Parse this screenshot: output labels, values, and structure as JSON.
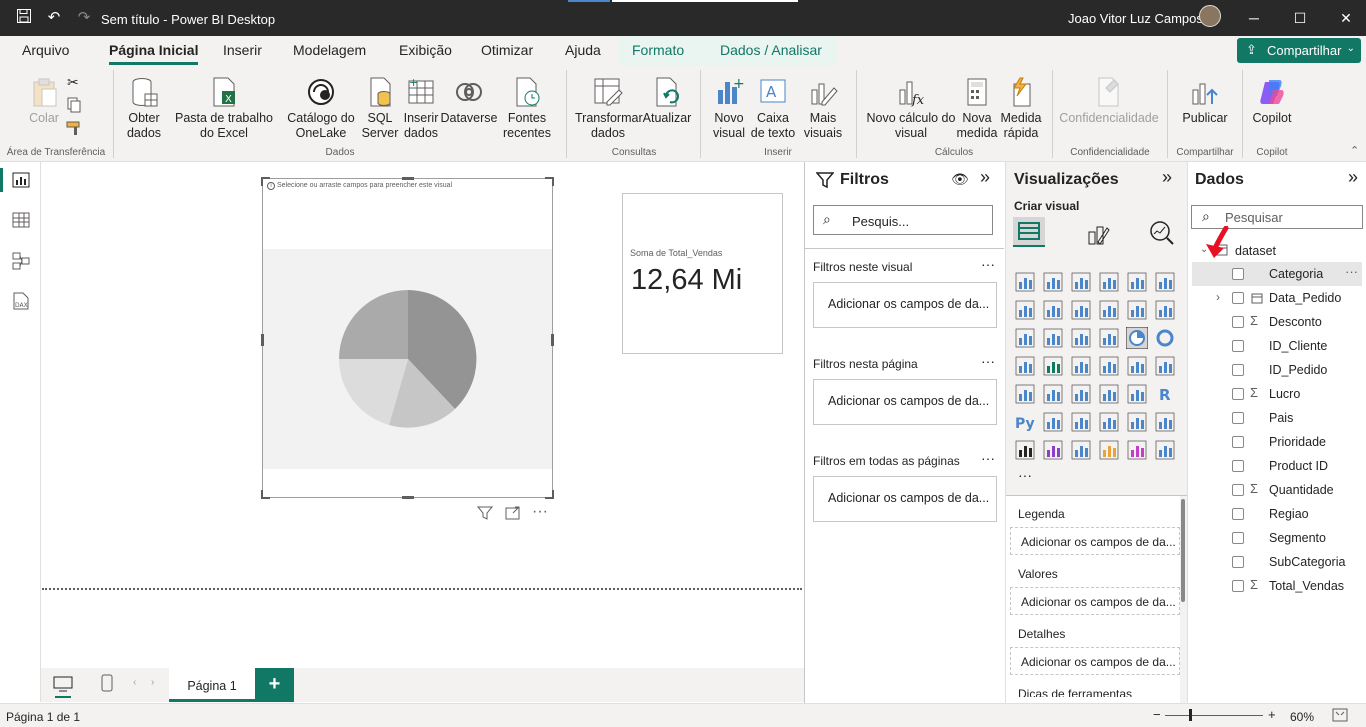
{
  "app": {
    "title": "Sem título - Power BI Desktop",
    "user": "Joao Vitor Luz Campos"
  },
  "tabs": [
    "Arquivo",
    "Página Inicial",
    "Inserir",
    "Modelagem",
    "Exibição",
    "Otimizar",
    "Ajuda",
    "Formato",
    "Dados / Analisar"
  ],
  "share_label": "Compartilhar",
  "ribbon": {
    "paste": "Colar",
    "get_data": "Obter dados",
    "excel": "Pasta de trabalho do Excel",
    "onelake": "Catálogo do OneLake",
    "sql": "SQL Server",
    "insert_data": "Inserir dados",
    "dataverse": "Dataverse",
    "recent": "Fontes recentes",
    "transform": "Transformar dados",
    "refresh": "Atualizar",
    "new_visual": "Novo visual",
    "textbox": "Caixa de texto",
    "more_visuals": "Mais visuais",
    "new_calc": "Novo cálculo do visual",
    "new_measure": "Nova medida",
    "quick_measure": "Medida rápida",
    "sensitivity": "Confidencialidade",
    "publish": "Publicar",
    "copilot": "Copilot",
    "groups": [
      "Área de Transferência",
      "Dados",
      "Consultas",
      "Inserir",
      "Cálculos",
      "Confidencialidade",
      "Compartilhar",
      "Copilot"
    ]
  },
  "canvas": {
    "hint": "Selecione ou arraste campos para preencher este visual",
    "card_label": "Soma de Total_Vendas",
    "card_value": "12,64 Mi",
    "pie_colors": [
      "#949495",
      "#c6c6c7",
      "#dcdcdd",
      "#aaaaab"
    ]
  },
  "pages": {
    "current": "Página 1",
    "add": "+"
  },
  "status": {
    "page": "Página 1 de 1",
    "zoom": "60%"
  },
  "filters": {
    "title": "Filtros",
    "search": "Pesquis...",
    "sections": [
      {
        "title": "Filtros neste visual",
        "box": "Adicionar os campos de da..."
      },
      {
        "title": "Filtros nesta página",
        "box": "Adicionar os campos de da..."
      },
      {
        "title": "Filtros em todas as páginas",
        "box": "Adicionar os campos de da..."
      }
    ]
  },
  "viz": {
    "title": "Visualizações",
    "build": "Criar visual",
    "wells": [
      {
        "label": "Legenda",
        "box": "Adicionar os campos de da..."
      },
      {
        "label": "Valores",
        "box": "Adicionar os campos de da..."
      },
      {
        "label": "Detalhes",
        "box": "Adicionar os campos de da..."
      }
    ],
    "cut_label": "Dicas de ferramentas"
  },
  "data": {
    "title": "Dados",
    "search": "Pesquisar",
    "table": "dataset",
    "fields": [
      {
        "name": "Categoria",
        "sigma": "",
        "expand": ""
      },
      {
        "name": "Data_Pedido",
        "sigma": "",
        "expand": "›"
      },
      {
        "name": "Desconto",
        "sigma": "Σ",
        "expand": ""
      },
      {
        "name": "ID_Cliente",
        "sigma": "",
        "expand": ""
      },
      {
        "name": "ID_Pedido",
        "sigma": "",
        "expand": ""
      },
      {
        "name": "Lucro",
        "sigma": "Σ",
        "expand": ""
      },
      {
        "name": "Pais",
        "sigma": "",
        "expand": ""
      },
      {
        "name": "Prioridade",
        "sigma": "",
        "expand": ""
      },
      {
        "name": "Product ID",
        "sigma": "",
        "expand": ""
      },
      {
        "name": "Quantidade",
        "sigma": "Σ",
        "expand": ""
      },
      {
        "name": "Regiao",
        "sigma": "",
        "expand": ""
      },
      {
        "name": "Segmento",
        "sigma": "",
        "expand": ""
      },
      {
        "name": "SubCategoria",
        "sigma": "",
        "expand": ""
      },
      {
        "name": "Total_Vendas",
        "sigma": "Σ",
        "expand": ""
      }
    ]
  }
}
